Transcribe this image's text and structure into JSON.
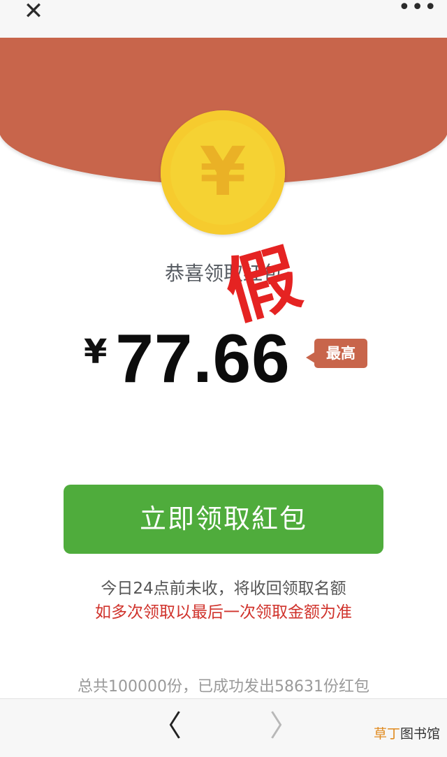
{
  "topbar": {
    "close_icon": "close-icon",
    "close_glyph": "✕",
    "more_icon": "more-icon",
    "more_glyph": "•••"
  },
  "envelope": {
    "color": "#c8654b",
    "coin_color": "#f5d233",
    "coin_icon": "yen-coin-icon",
    "coin_glyph": "¥"
  },
  "content": {
    "congrats": "恭喜领取红包",
    "stamp_text": "假",
    "currency": "¥",
    "amount": "77.66",
    "badge": "最高"
  },
  "action": {
    "button_label": "立即领取紅包",
    "button_color": "#4fac3c"
  },
  "notices": {
    "line1": "今日24点前未收，将收回领取名额",
    "line2": "如多次领取以最后一次领取金额为准",
    "total": "总共100000份，已成功发出58631份红包"
  },
  "bottombar": {
    "back_icon": "chevron-left-icon",
    "back_glyph": "〈",
    "forward_icon": "chevron-right-icon",
    "forward_glyph": "〉",
    "watermark_a": "草丁",
    "watermark_b": "图书馆"
  }
}
